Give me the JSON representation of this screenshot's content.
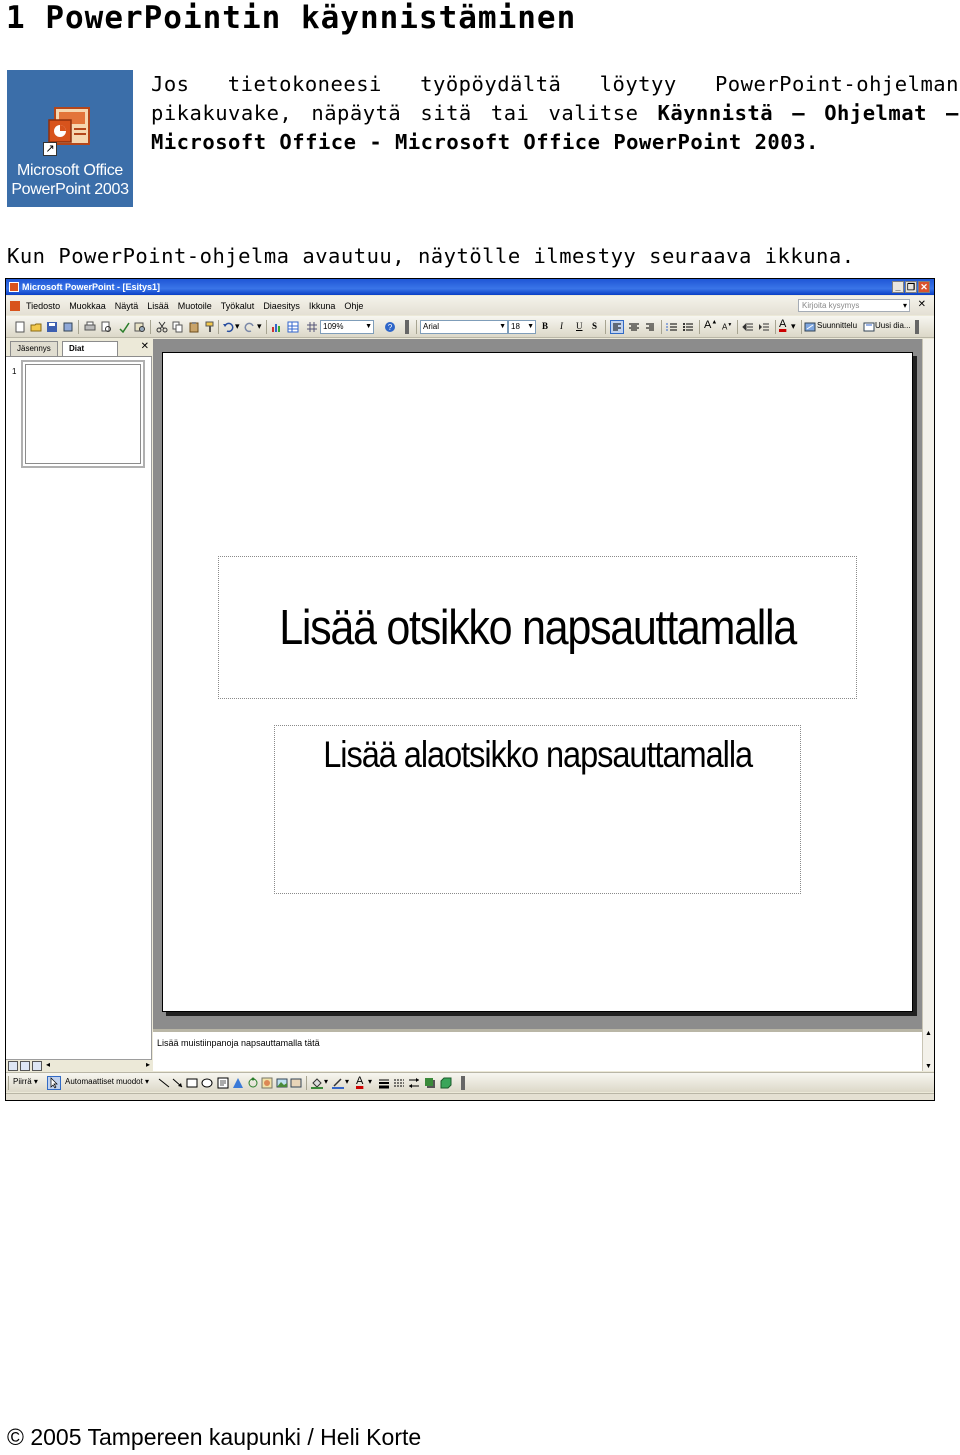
{
  "heading": "1 PowerPointin käynnistäminen",
  "shortcut": {
    "label_line1": "Microsoft Office",
    "label_line2": "PowerPoint 2003"
  },
  "intro": {
    "line1": [
      "Jos",
      "tietokoneesi",
      "työpöydältä",
      "löytyy",
      "PowerPoint-ohjelman"
    ],
    "line2_plain": [
      "pikakuvake,",
      "näpäytä",
      "sitä",
      "tai",
      "valitse"
    ],
    "line2_bold": [
      "Käynnistä",
      "–",
      "Ohjelmat",
      "–"
    ],
    "line3_bold": "Microsoft Office - Microsoft Office PowerPoint 2003."
  },
  "second_paragraph": "Kun PowerPoint-ohjelma avautuu, näytölle ilmestyy seuraava ikkuna.",
  "window": {
    "title": "Microsoft PowerPoint - [Esitys1]",
    "menu": [
      "Tiedosto",
      "Muokkaa",
      "Näytä",
      "Lisää",
      "Muotoile",
      "Työkalut",
      "Diaesitys",
      "Ikkuna",
      "Ohje"
    ],
    "help_placeholder": "Kirjoita kysymys",
    "zoom": "109%",
    "font_name": "Arial",
    "font_size": "18",
    "bold_label": "B",
    "italic_label": "I",
    "underline_label": "U",
    "shadow_label": "S",
    "design_label": "Suunnittelu",
    "new_slide_label": "Uusi dia...",
    "pane_tabs": [
      "Jäsennys",
      "Diat"
    ],
    "slide_number": "1",
    "title_placeholder": "Lisää otsikko napsauttamalla",
    "subtitle_placeholder": "Lisää alaotsikko napsauttamalla",
    "notes_placeholder": "Lisää muistiinpanoja napsauttamalla tätä",
    "draw_label": "Piirrä",
    "autoshapes_label": "Automaattiset muodot"
  },
  "footer": "© 2005 Tampereen kaupunki / Heli Korte",
  "colors": {
    "desktop_blue": "#3b6ea9",
    "titlebar_blue": "#1f56d6",
    "powerpoint_orange": "#d8531c"
  }
}
